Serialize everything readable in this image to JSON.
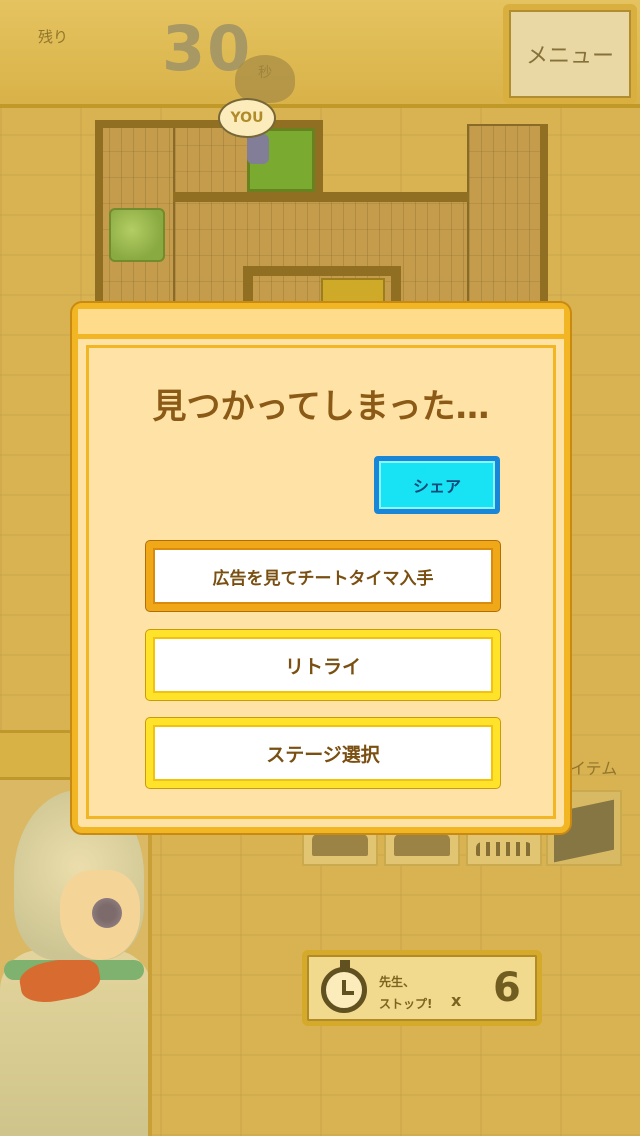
{
  "header": {
    "remaining_label": "残り",
    "timer_value": "30",
    "seconds_label": "秒",
    "menu_label": "メニュー"
  },
  "map": {
    "player_label": "YOU"
  },
  "items": {
    "label": "イテム"
  },
  "stop_item": {
    "line1": "先生、",
    "line2": "ストップ!",
    "multiplier": "x",
    "count": "6"
  },
  "dialog": {
    "title": "見つかってしまった…",
    "share_label": "シェア",
    "ad_cheat_label": "広告を見てチートタイマ入手",
    "retry_label": "リトライ",
    "stage_select_label": "ステージ選択"
  },
  "colors": {
    "dialog_bg": "#ffe2a6",
    "dialog_border": "#f2b524",
    "share_button": "#18e3f4",
    "title_text": "#8a5a16"
  }
}
